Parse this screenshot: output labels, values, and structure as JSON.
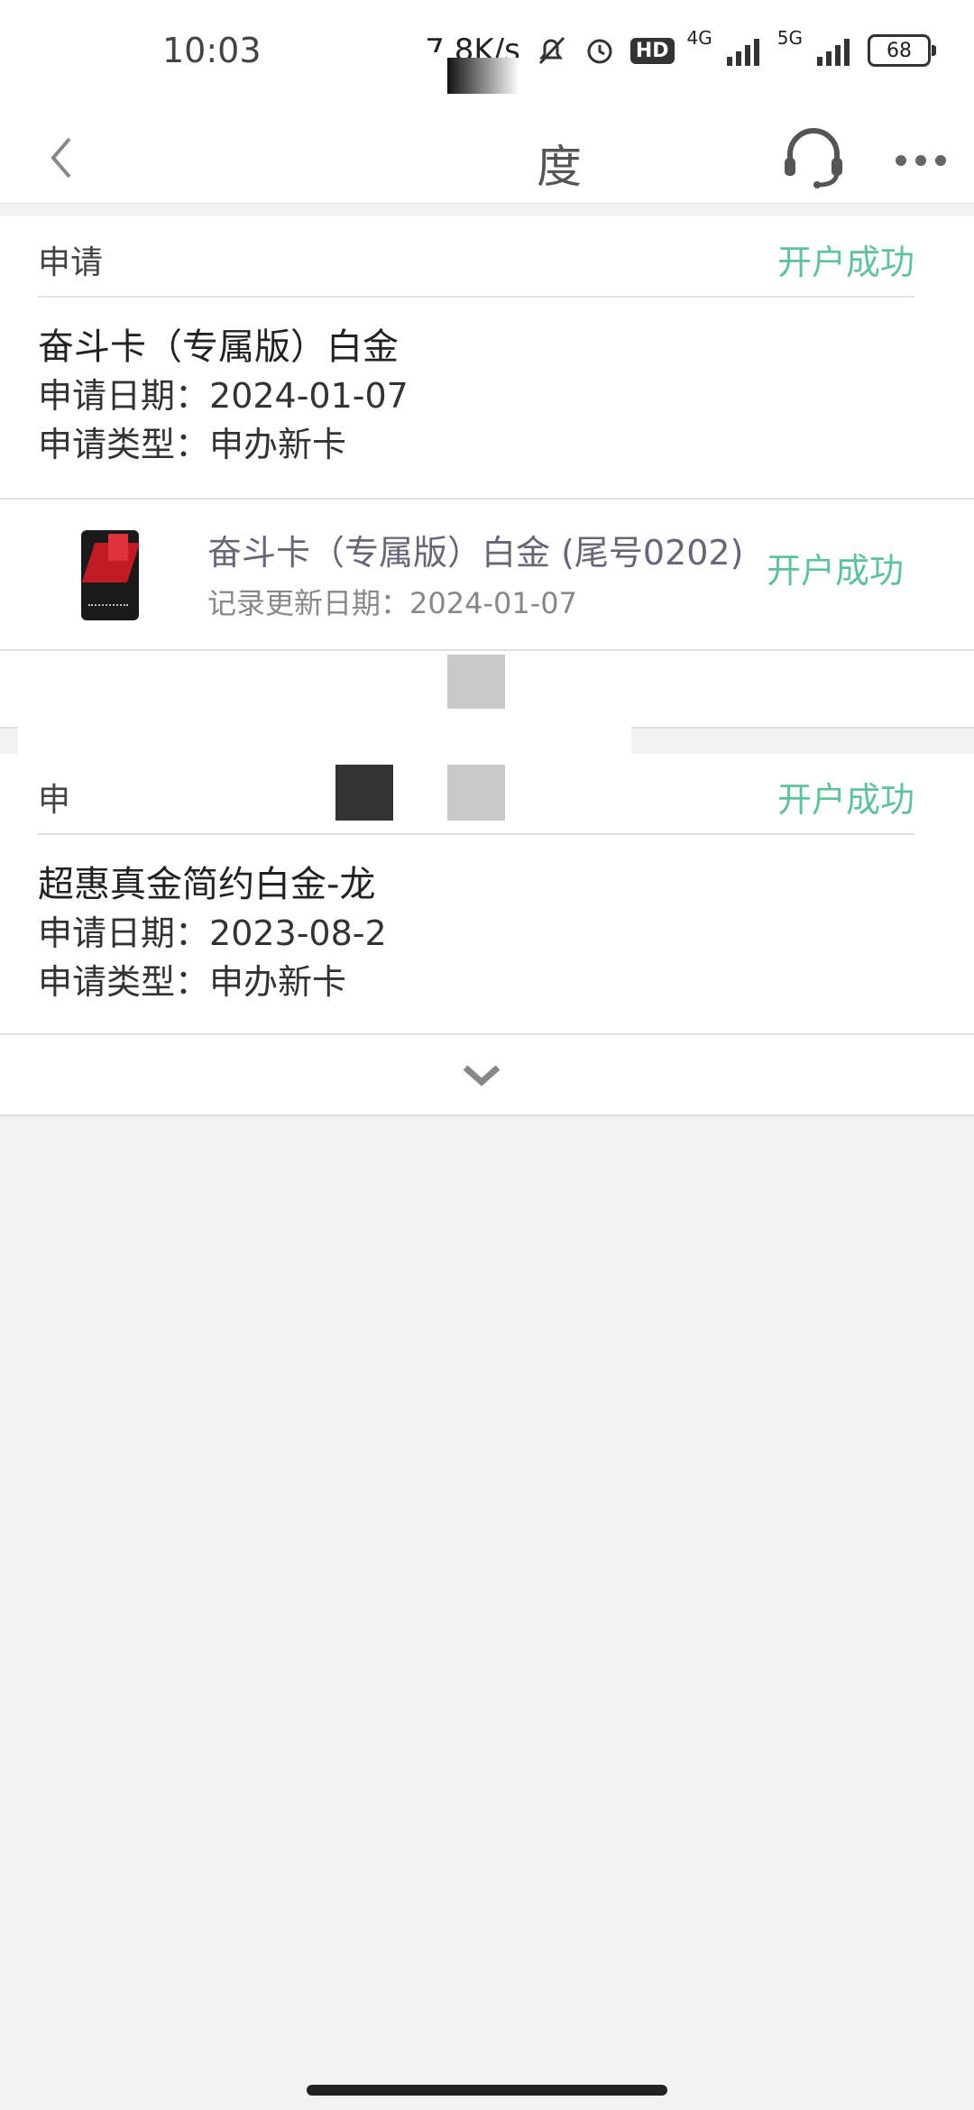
{
  "status_bar": {
    "time": "10:03",
    "network_speed": "7.8K/s",
    "hd_badge": "HD",
    "net_4g": "4G",
    "net_5g": "5G",
    "battery": "68",
    "icons": [
      "mute-icon",
      "alarm-icon",
      "signal-icon",
      "battery-icon"
    ]
  },
  "nav": {
    "title_visible": "度",
    "back_icon": "back-chevron-icon",
    "headset_icon": "headset-icon",
    "more_icon": "more-dots-icon"
  },
  "applications": [
    {
      "head_label": "申请",
      "status": "开户成功",
      "card_name": "奋斗卡（专属版）白金",
      "apply_date_label": "申请日期：",
      "apply_date": "2024-01-07",
      "apply_type_label": "申请类型：",
      "apply_type": "申办新卡",
      "detail": {
        "title": "奋斗卡（专属版）白金 (尾号0202)",
        "updated_label": "记录更新日期：",
        "updated_date": "2024-01-07",
        "status": "开户成功"
      }
    },
    {
      "head_label": "申",
      "status": "开户成功",
      "card_name": "超惠真金简约白金-龙",
      "apply_date_label": "申请日期：",
      "apply_date": "2023-08-2",
      "apply_type_label": "申请类型：",
      "apply_type": "申办新卡"
    }
  ],
  "colors": {
    "success_green": "#5ec29a",
    "page_bg": "#f2f2f2",
    "card_bg": "#ffffff"
  }
}
